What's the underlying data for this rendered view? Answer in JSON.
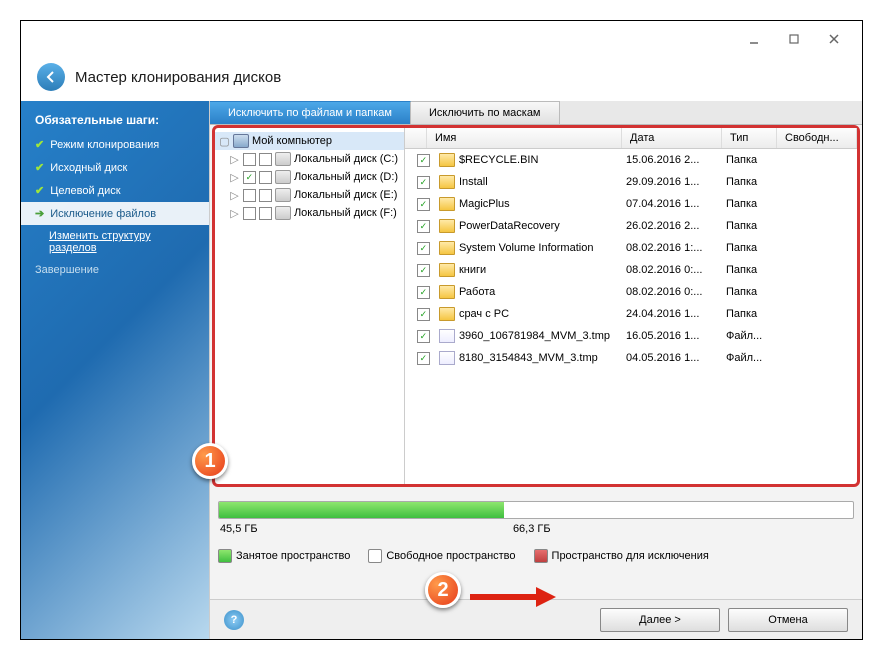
{
  "window": {
    "title": "Мастер клонирования дисков"
  },
  "sidebar": {
    "header": "Обязательные шаги:",
    "items": [
      {
        "label": "Режим клонирования",
        "done": true
      },
      {
        "label": "Исходный диск",
        "done": true
      },
      {
        "label": "Целевой диск",
        "done": true
      },
      {
        "label": "Исключение файлов",
        "active": true
      },
      {
        "label": "Изменить структуру разделов",
        "sub": true
      },
      {
        "label": "Завершение",
        "disabled": true
      }
    ]
  },
  "tabs": {
    "active": "Исключить по файлам и папкам",
    "other": "Исключить по маскам"
  },
  "tree": {
    "root": "Мой компьютер",
    "drives": [
      {
        "label": "Локальный диск (C:)",
        "checked": false
      },
      {
        "label": "Локальный диск (D:)",
        "checked": true
      },
      {
        "label": "Локальный диск (E:)",
        "checked": false
      },
      {
        "label": "Локальный диск (F:)",
        "checked": false
      }
    ]
  },
  "columns": {
    "name": "Имя",
    "date": "Дата",
    "type": "Тип",
    "free": "Свободн..."
  },
  "files": [
    {
      "name": "$RECYCLE.BIN",
      "date": "15.06.2016 2...",
      "type": "Папка",
      "kind": "folder"
    },
    {
      "name": "Install",
      "date": "29.09.2016 1...",
      "type": "Папка",
      "kind": "folder"
    },
    {
      "name": "MagicPlus",
      "date": "07.04.2016 1...",
      "type": "Папка",
      "kind": "folder"
    },
    {
      "name": "PowerDataRecovery",
      "date": "26.02.2016 2...",
      "type": "Папка",
      "kind": "folder"
    },
    {
      "name": "System Volume Information",
      "date": "08.02.2016 1:...",
      "type": "Папка",
      "kind": "folder"
    },
    {
      "name": "книги",
      "date": "08.02.2016 0:...",
      "type": "Папка",
      "kind": "folder"
    },
    {
      "name": "Работа",
      "date": "08.02.2016 0:...",
      "type": "Папка",
      "kind": "folder"
    },
    {
      "name": "срач с PC",
      "date": "24.04.2016 1...",
      "type": "Папка",
      "kind": "folder"
    },
    {
      "name": "3960_106781984_MVM_3.tmp",
      "date": "16.05.2016 1...",
      "type": "Файл...",
      "kind": "file"
    },
    {
      "name": "8180_3154843_MVM_3.tmp",
      "date": "04.05.2016 1...",
      "type": "Файл...",
      "kind": "file"
    }
  ],
  "capacity": {
    "used_label": "45,5 ГБ",
    "total_label": "66,3 ГБ",
    "used_percent": 45
  },
  "legend": {
    "used": "Занятое пространство",
    "free": "Свободное пространство",
    "excl": "Пространство для исключения"
  },
  "buttons": {
    "next": "Далее >",
    "cancel": "Отмена"
  },
  "annot": {
    "one": "1",
    "two": "2"
  }
}
